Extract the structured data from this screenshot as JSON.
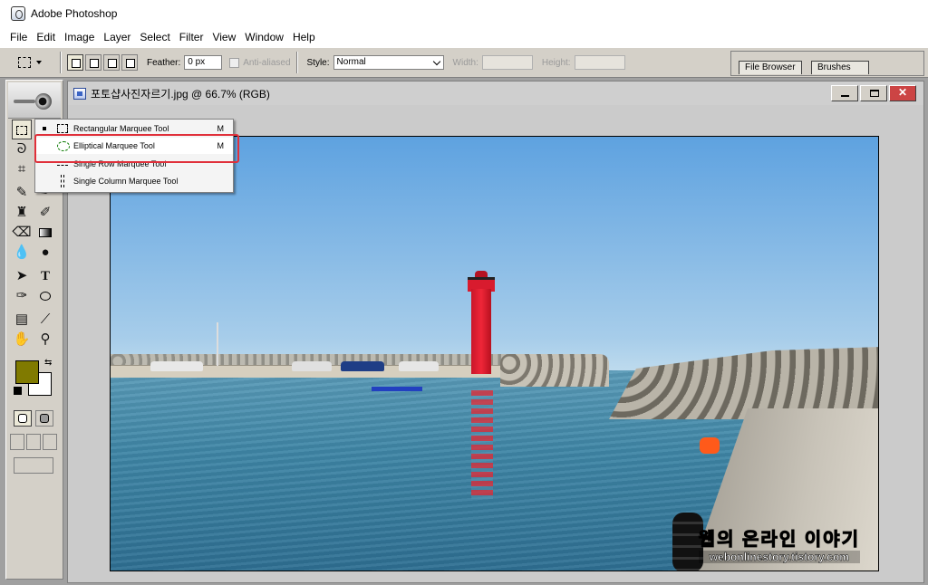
{
  "app": {
    "title": "Adobe Photoshop"
  },
  "menu": [
    "File",
    "Edit",
    "Image",
    "Layer",
    "Select",
    "Filter",
    "View",
    "Window",
    "Help"
  ],
  "options": {
    "feather_label": "Feather:",
    "feather_value": "0 px",
    "antialias_label": "Anti-aliased",
    "style_label": "Style:",
    "style_value": "Normal",
    "width_label": "Width:",
    "height_label": "Height:"
  },
  "palette_well": {
    "tabs": [
      "File Browser",
      "Brushes"
    ]
  },
  "toolbox": {
    "foreground_color": "#807a00",
    "background_color": "#ffffff"
  },
  "document": {
    "title": "포토샵사진자르기.jpg @ 66.7% (RGB)",
    "window_buttons": [
      "minimize-icon",
      "restore-icon",
      "close-icon"
    ]
  },
  "flyout": {
    "items": [
      {
        "label": "Rectangular Marquee Tool",
        "key": "M",
        "icon": "rectangular-marquee-icon"
      },
      {
        "label": "Elliptical Marquee Tool",
        "key": "M",
        "icon": "elliptical-marquee-icon"
      },
      {
        "label": "Single Row Marquee Tool",
        "key": "",
        "icon": "single-row-marquee-icon"
      },
      {
        "label": "Single Column Marquee Tool",
        "key": "",
        "icon": "single-column-marquee-icon"
      }
    ],
    "highlight_color": "#e0303a"
  },
  "watermark": {
    "line1": "웹의 온라인 이야기",
    "line2": "webonlinestory.tistory.com"
  }
}
